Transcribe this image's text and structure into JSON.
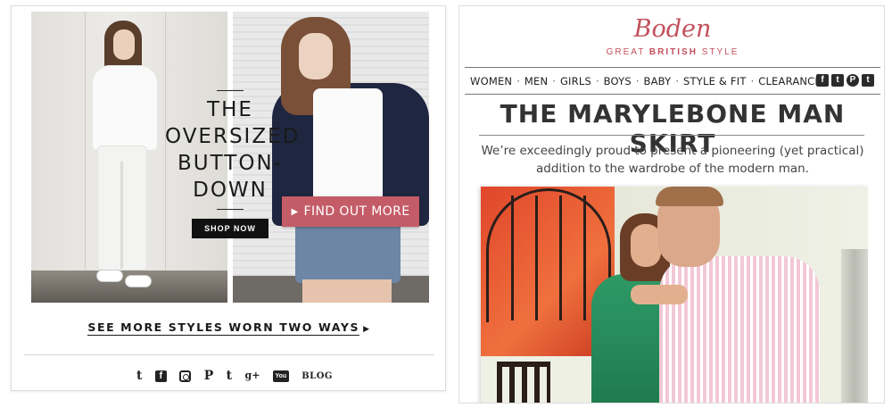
{
  "left_email": {
    "hero": {
      "title_lines": [
        "THE",
        "OVERSIZED",
        "BUTTON-",
        "DOWN"
      ],
      "cta_label": "SHOP NOW"
    },
    "see_more_label": "SEE MORE STYLES WORN TWO WAYS",
    "see_more_arrow": "▶",
    "social": {
      "twitter": "t",
      "facebook": "f",
      "pinterest": "P",
      "tumblr": "t",
      "googleplus": "g+",
      "youtube": "You",
      "blog": "BLOG"
    }
  },
  "right_email": {
    "brand": "Boden",
    "tagline_pre": "GREAT ",
    "tagline_bold": "BRITISH",
    "tagline_post": " STYLE",
    "nav_items": [
      "WOMEN",
      "MEN",
      "GIRLS",
      "BOYS",
      "BABY",
      "STYLE & FIT",
      "CLEARANCE"
    ],
    "nav_separator": "·",
    "nav_social": [
      "f",
      "t",
      "P",
      "t"
    ],
    "headline": "THE MARYLEBONE MAN SKIRT",
    "subcopy": "We’re exceedingly proud to present a pioneering (yet practical) addition to the wardrobe of the modern man.",
    "cta_label": "FIND OUT MORE",
    "cta_arrow": "▶"
  },
  "colors": {
    "brand_accent": "#c2505d",
    "cta_background": "#c45c68",
    "shop_now_background": "#111111"
  }
}
